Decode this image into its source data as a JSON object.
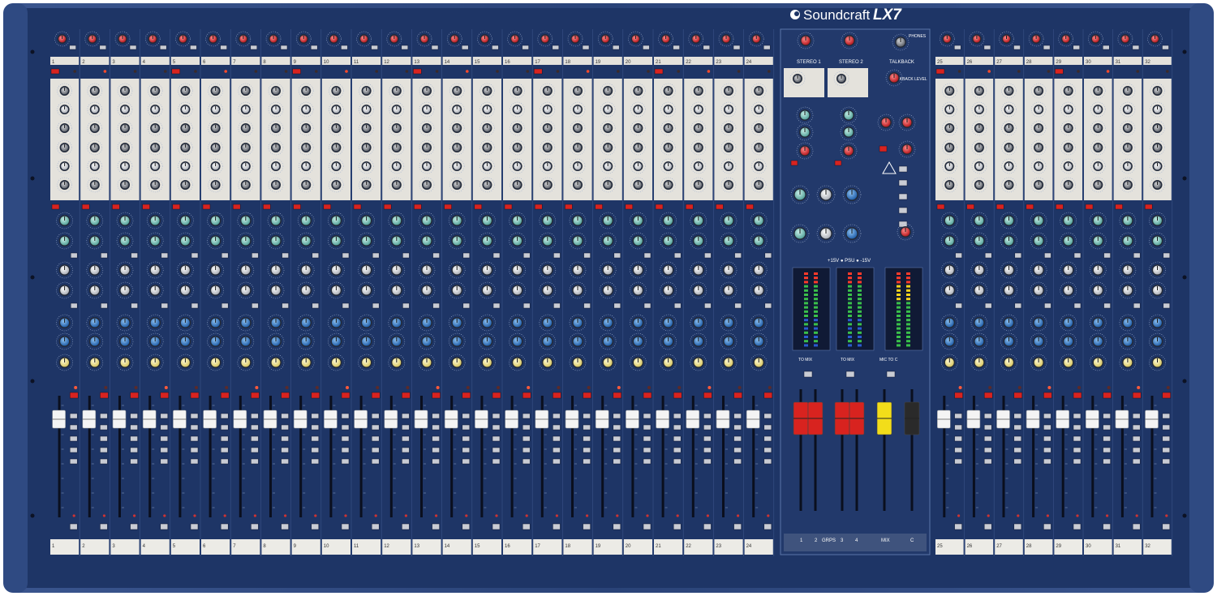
{
  "brand": {
    "name": "Soundcraft",
    "model": "LX7"
  },
  "channels": {
    "left_numbers": [
      "1",
      "2",
      "3",
      "4",
      "5",
      "6",
      "7",
      "8",
      "9",
      "10",
      "11",
      "12",
      "13",
      "14",
      "15",
      "16",
      "17",
      "18",
      "19",
      "20",
      "21",
      "22",
      "23",
      "24"
    ],
    "right_numbers": [
      "25",
      "26",
      "27",
      "28",
      "29",
      "30",
      "31",
      "32"
    ]
  },
  "master": {
    "stereo1_label": "STEREO 1",
    "stereo2_label": "STEREO 2",
    "talkback_label": "TALKBACK",
    "phones_label": "PHONES",
    "talkback_level_label": "TALKBACK LEVEL",
    "power_label": "+15V  ● PSU ●  -15V",
    "grps_label": "GRPS",
    "mix_label": "MIX",
    "c_label": "C",
    "group_numbers": [
      "1",
      "2",
      "3",
      "4"
    ],
    "to_mix_label": "TO MIX",
    "mic_label": "MIC TO C"
  },
  "colors": {
    "panel": "#1e3566",
    "panel_dark": "#14254b",
    "frame": "#2b447a",
    "cream": "#e4e2dc",
    "knob_red": "#d9262c",
    "knob_teal": "#7fc6bd",
    "knob_blue": "#2c78c8",
    "knob_yellow": "#f0e38a",
    "fader_red": "#d8231f",
    "fader_yellow": "#f2dd1a"
  }
}
